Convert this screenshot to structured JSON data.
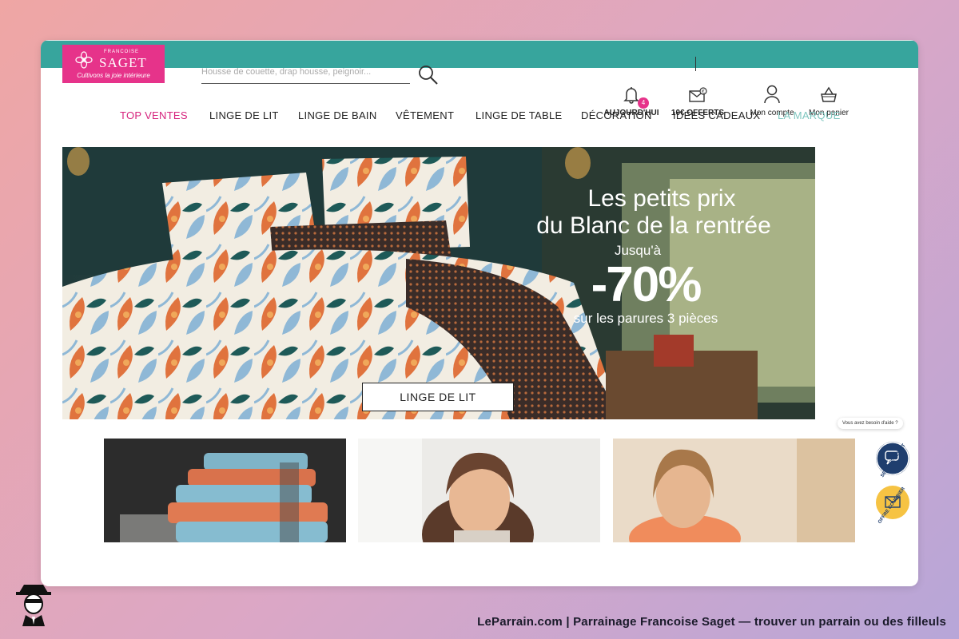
{
  "logo": {
    "small": "FRANCOISE",
    "brand": "SAGET",
    "tagline": "Cultivons la joie intérieure"
  },
  "search": {
    "placeholder": "Housse de couette, drap housse, peignoir..."
  },
  "header_icons": {
    "today": {
      "label": "AUJOURD'HUI",
      "badge": "4"
    },
    "offer": {
      "label": "10€ OFFERTS"
    },
    "account": {
      "label": "Mon compte"
    },
    "cart": {
      "label": "Mon panier"
    }
  },
  "nav": {
    "items": [
      {
        "label": "TOP VENTES",
        "color": "#d6237d"
      },
      {
        "label": "LINGE DE LIT",
        "color": "#222222"
      },
      {
        "label": "LINGE DE BAIN",
        "color": "#222222"
      },
      {
        "label": "VÊTEMENT",
        "color": "#222222"
      },
      {
        "label": "LINGE DE TABLE",
        "color": "#222222"
      },
      {
        "label": "DÉCORATION",
        "color": "#222222"
      },
      {
        "label": "IDÉES CADEAUX",
        "color": "#222222"
      },
      {
        "label": "LA MARQUE",
        "color": "#7fc6bf"
      }
    ]
  },
  "hero": {
    "line1": "Les petits prix",
    "line2": "du Blanc de la rentrée",
    "line3": "Jusqu'à",
    "discount": "-70%",
    "line4": "sur les parures 3 pièces",
    "button": "LINGE DE LIT"
  },
  "widgets": {
    "help": "Vous avez besoin d'aide ?",
    "service": "SERVICE CLIENT",
    "mail": "OFFRE COURRIER"
  },
  "caption": "LeParrain.com | Parrainage Francoise Saget — trouver un parrain ou des filleuls",
  "colors": {
    "teal": "#37a59d",
    "pink": "#e6338a",
    "navy": "#1f3e6e",
    "gold": "#f6c343"
  }
}
